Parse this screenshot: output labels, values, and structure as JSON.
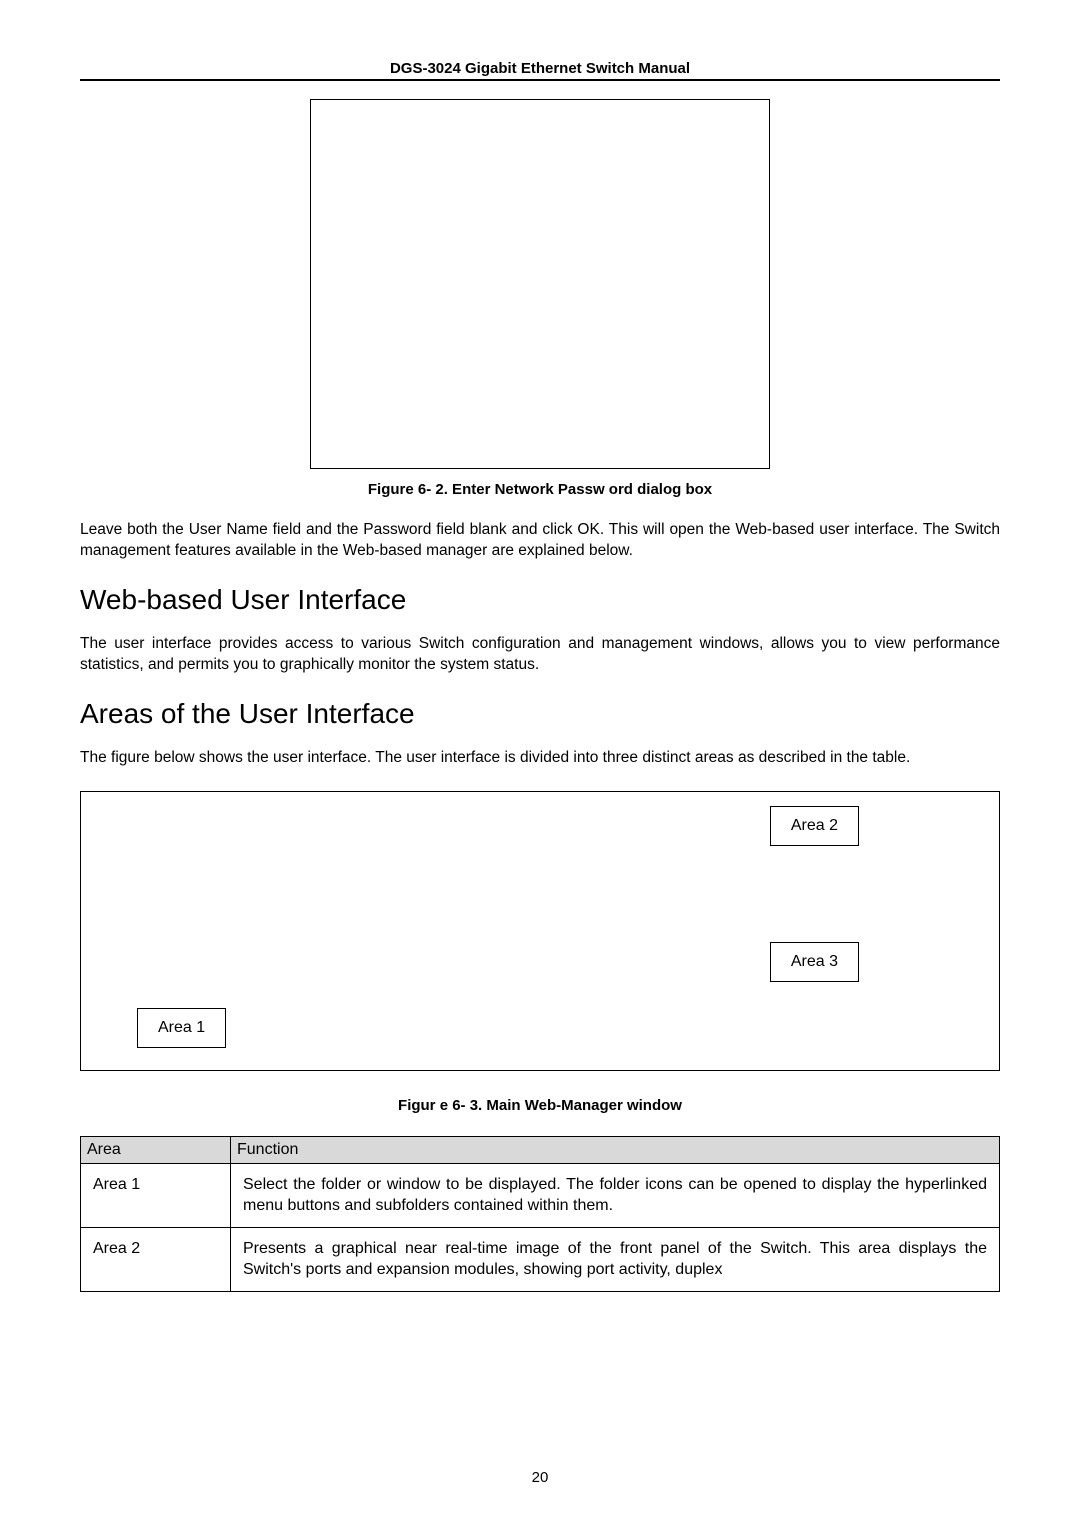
{
  "header": {
    "title": "DGS-3024 Gigabit Ethernet Switch Manual"
  },
  "figure1": {
    "caption": "Figure 6- 2.  Enter Network Passw ord dialog box"
  },
  "para1": "Leave both the User Name field and the Password field blank and click OK. This will open the Web-based user interface. The Switch management features available in the Web-based manager are explained below.",
  "heading1": "Web-based User Interface",
  "para2": "The user interface provides access to various Switch configuration and management windows, allows you to view performance statistics, and permits you to graphically monitor the system status.",
  "heading2": "Areas of the User Interface",
  "para3": "The figure below shows the user interface. The user interface is divided into three distinct areas as described in the table.",
  "diagram": {
    "area1": "Area 1",
    "area2": "Area 2",
    "area3": "Area 3"
  },
  "figure2": {
    "caption": "Figur e 6- 3.  Main Web-Manager window"
  },
  "table": {
    "header_area": "Area",
    "header_function": "Function",
    "rows": [
      {
        "area": "Area 1",
        "function": "Select the folder or window to be displayed. The folder icons can be opened to display the hyperlinked menu buttons and subfolders contained within them."
      },
      {
        "area": "Area 2",
        "function": "Presents a graphical near real-time image of the front panel of the Switch. This area displays the Switch's ports and expansion modules, showing port activity, duplex"
      }
    ]
  },
  "page_number": "20"
}
